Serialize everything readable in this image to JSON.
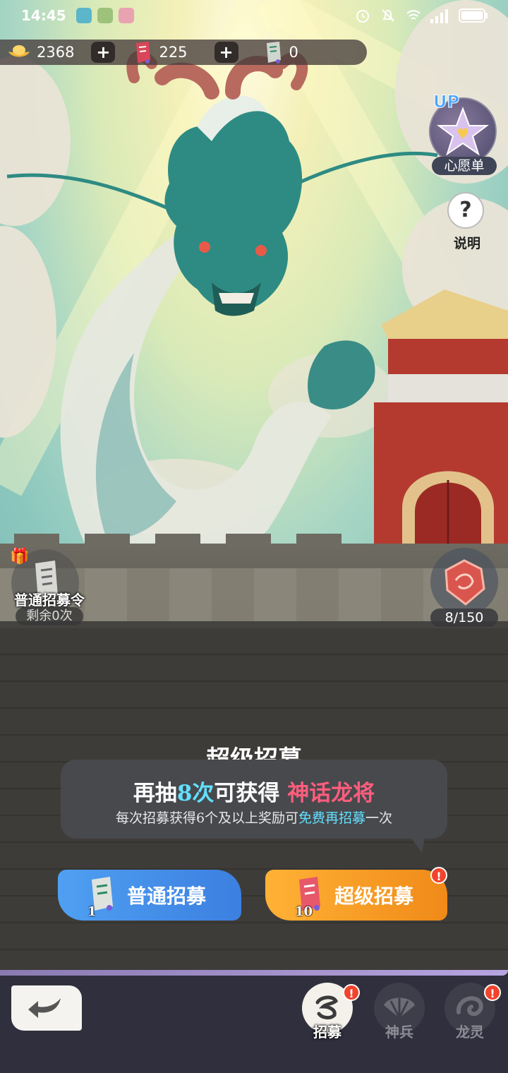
{
  "status_bar": {
    "time": "14:45",
    "icons": [
      "alarm-icon",
      "mute-icon",
      "wifi-icon",
      "signal-icon",
      "battery-icon"
    ]
  },
  "currency": {
    "gold": "2368",
    "super_tickets": "225",
    "normal_tickets": "0",
    "plus": "+"
  },
  "side": {
    "up_badge": "UP",
    "wishlist_label": "心愿单",
    "help_symbol": "?",
    "help_label": "说明"
  },
  "ticket": {
    "name": "普通招募令",
    "remaining": "剩余0次"
  },
  "dragon_token": {
    "progress": "8/150",
    "current": 8,
    "max": 150
  },
  "recruit": {
    "title": "超级招募",
    "line1_prefix": "再抽",
    "line1_count": "8次",
    "line1_mid": "可获得",
    "line1_reward": "神话龙将",
    "line2_prefix": "每次招募获得6个及以上奖励可",
    "line2_free": "免费再招募",
    "line2_suffix": "一次"
  },
  "buttons": {
    "normal_label": "普通招募",
    "normal_cost": "1",
    "super_label": "超级招募",
    "super_cost": "10",
    "alert": "!"
  },
  "nav": {
    "tabs": [
      {
        "label": "招募",
        "active": true,
        "alert": "!"
      },
      {
        "label": "神兵",
        "active": false,
        "alert": ""
      },
      {
        "label": "龙灵",
        "active": false,
        "alert": "!"
      }
    ]
  },
  "colors": {
    "highlight_cyan": "#62e0ff",
    "highlight_pink": "#ff5d7d",
    "normal_button": "#4fa0f2",
    "super_button": "#f8a22a",
    "alert_red": "#f0442c"
  }
}
